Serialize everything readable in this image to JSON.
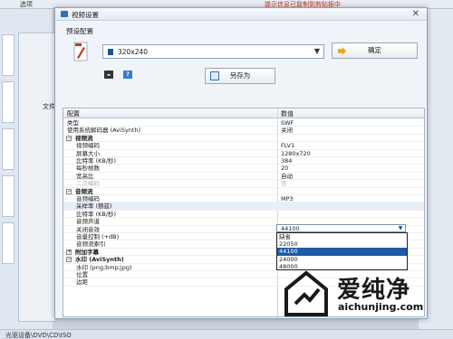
{
  "background_app": {
    "top_menu_item": "选项",
    "top_right_text": "提示信息已复制到剪贴板中",
    "side_label": "文件",
    "status_bar": "光驱设备\\DVD\\CD\\ISO"
  },
  "dialog": {
    "title": "视频设置",
    "preset_label": "预设配置",
    "preset_value": "320x240",
    "ok_button": "确定",
    "save_as_button": "另存为",
    "grid": {
      "col_config": "配置",
      "col_value": "数值",
      "rows": [
        {
          "k": "类型",
          "v": "SWF",
          "style": "plain"
        },
        {
          "k": "使用系统解码器 (AviSynth)",
          "v": "关闭",
          "style": "plain"
        },
        {
          "k": "视频流",
          "v": "",
          "style": "cat"
        },
        {
          "k": "视频编码",
          "v": "FLV1",
          "style": "sub"
        },
        {
          "k": "屏幕大小",
          "v": "1280x720",
          "style": "sub"
        },
        {
          "k": "比特率 (KB/秒)",
          "v": "384",
          "style": "sub"
        },
        {
          "k": "每秒帧数",
          "v": "20",
          "style": "sub"
        },
        {
          "k": "宽高比",
          "v": "自动",
          "style": "sub"
        },
        {
          "k": "二次编码",
          "v": "否",
          "style": "sub-disabled"
        },
        {
          "k": "音频流",
          "v": "",
          "style": "cat"
        },
        {
          "k": "音频编码",
          "v": "MP3",
          "style": "sub"
        },
        {
          "k": "采样率 (赫兹)",
          "v": "",
          "style": "sub-selected"
        },
        {
          "k": "比特率 (KB/秒)",
          "v": "",
          "style": "sub"
        },
        {
          "k": "音频声道",
          "v": "",
          "style": "sub"
        },
        {
          "k": "关闭音效",
          "v": "",
          "style": "sub"
        },
        {
          "k": "音量控制 (+dB)",
          "v": "",
          "style": "sub"
        },
        {
          "k": "音频流索引",
          "v": "缺省",
          "style": "sub"
        },
        {
          "k": "附加字幕",
          "v": "",
          "style": "cat-collapsed"
        },
        {
          "k": "水印 (AviSynth)",
          "v": "",
          "style": "cat-expanded"
        },
        {
          "k": "水印 (png;bmp;jpg)",
          "v": "",
          "style": "sub"
        },
        {
          "k": "位置",
          "v": "",
          "style": "sub"
        },
        {
          "k": "边距",
          "v": "",
          "style": "sub"
        }
      ]
    },
    "sample_rate_dropdown": {
      "current": "44100",
      "options": [
        "缺省",
        "22050",
        "44100",
        "24000",
        "48000"
      ],
      "highlighted_index": 2
    }
  },
  "watermark": {
    "brand": "爱纯净",
    "url": "aichunjing.com"
  },
  "colors": {
    "selection": "#1f5aa6",
    "dialog_bg": "#f0f4f9"
  }
}
